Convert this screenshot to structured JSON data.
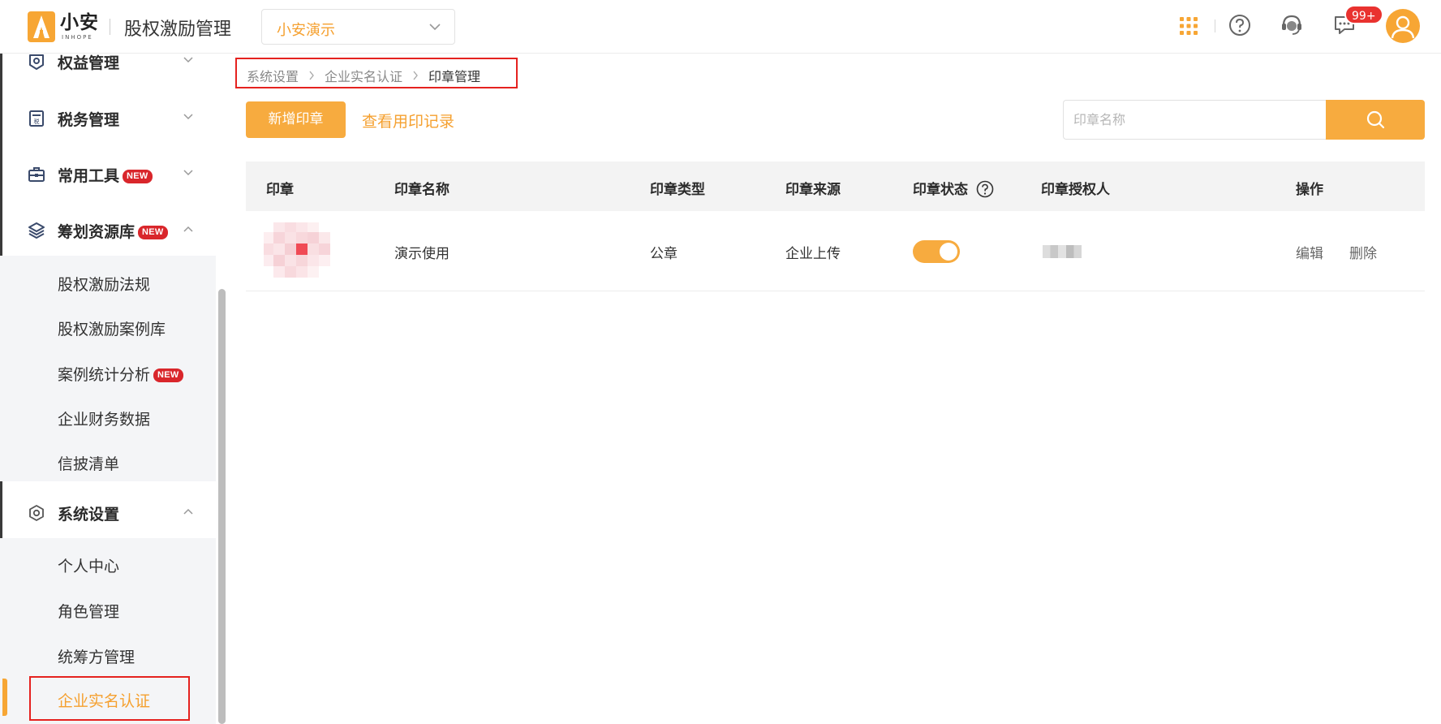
{
  "header": {
    "logo_cn": "小安",
    "logo_en": "INHOPE",
    "app_title": "股权激励管理",
    "company": "小安演示",
    "notification_badge": "99+"
  },
  "sidebar": {
    "groups": [
      {
        "label": "权益管理",
        "icon": "rights-icon",
        "expanded": false
      },
      {
        "label": "税务管理",
        "icon": "tax-icon",
        "expanded": false
      },
      {
        "label": "常用工具",
        "icon": "toolbox-icon",
        "expanded": false,
        "badge": "NEW"
      },
      {
        "label": "筹划资源库",
        "icon": "layers-icon",
        "expanded": true,
        "badge": "NEW"
      },
      {
        "label": "系统设置",
        "icon": "settings-icon",
        "expanded": true
      }
    ],
    "resource_items": [
      {
        "label": "股权激励法规"
      },
      {
        "label": "股权激励案例库"
      },
      {
        "label": "案例统计分析",
        "badge": "NEW"
      },
      {
        "label": "企业财务数据"
      },
      {
        "label": "信披清单"
      }
    ],
    "settings_items": [
      {
        "label": "个人中心"
      },
      {
        "label": "角色管理"
      },
      {
        "label": "统筹方管理"
      },
      {
        "label": "企业实名认证",
        "active": true
      }
    ]
  },
  "breadcrumb": [
    "系统设置",
    "企业实名认证",
    "印章管理"
  ],
  "toolbar": {
    "add_label": "新增印章",
    "log_label": "查看用印记录",
    "search_placeholder": "印章名称",
    "search_value": ""
  },
  "table": {
    "columns": [
      "印章",
      "印章名称",
      "印章类型",
      "印章来源",
      "印章状态",
      "印章授权人",
      "操作"
    ],
    "rows": [
      {
        "name": "演示使用",
        "type": "公章",
        "source": "企业上传",
        "status_on": true,
        "actions": [
          "编辑",
          "删除"
        ]
      }
    ]
  },
  "colors": {
    "accent": "#f7ab3f",
    "accent_text": "#f5a02f",
    "badge_red": "#d9262b",
    "highlight_border": "#e5221f"
  }
}
